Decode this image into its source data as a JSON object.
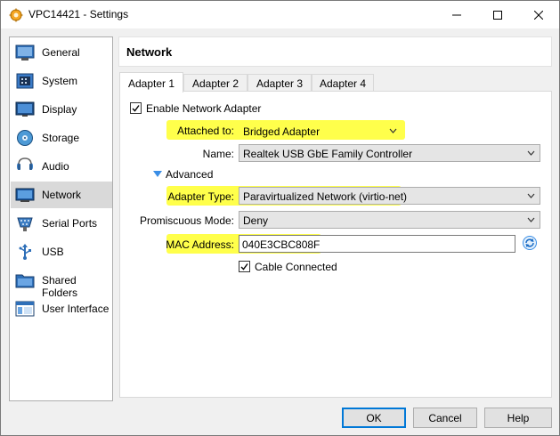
{
  "window": {
    "title": "VPC14421 - Settings"
  },
  "sidebar": {
    "items": [
      {
        "label": "General",
        "icon": "general-icon"
      },
      {
        "label": "System",
        "icon": "system-icon"
      },
      {
        "label": "Display",
        "icon": "display-icon"
      },
      {
        "label": "Storage",
        "icon": "storage-icon"
      },
      {
        "label": "Audio",
        "icon": "audio-icon"
      },
      {
        "label": "Network",
        "icon": "network-icon"
      },
      {
        "label": "Serial Ports",
        "icon": "serial-ports-icon"
      },
      {
        "label": "USB",
        "icon": "usb-icon"
      },
      {
        "label": "Shared Folders",
        "icon": "shared-folders-icon"
      },
      {
        "label": "User Interface",
        "icon": "user-interface-icon"
      }
    ],
    "selected": "Network"
  },
  "content": {
    "header": "Network",
    "tabs": [
      {
        "label": "Adapter 1"
      },
      {
        "label": "Adapter 2"
      },
      {
        "label": "Adapter 3"
      },
      {
        "label": "Adapter 4"
      }
    ],
    "active_tab": "Adapter 1"
  },
  "adapter": {
    "enable_label": "Enable Network Adapter",
    "enable_checked": true,
    "attached_label": "Attached to:",
    "attached_value": "Bridged Adapter",
    "name_label": "Name:",
    "name_value": "Realtek USB GbE Family Controller",
    "advanced_label": "Advanced",
    "adapter_type_label": "Adapter Type:",
    "adapter_type_value": "Paravirtualized Network (virtio-net)",
    "promiscuous_label": "Promiscuous Mode:",
    "promiscuous_value": "Deny",
    "mac_label": "MAC Address:",
    "mac_value": "040E3CBC808F",
    "cable_label": "Cable Connected",
    "cable_checked": true
  },
  "buttons": {
    "ok": "OK",
    "cancel": "Cancel",
    "help": "Help"
  },
  "colors": {
    "highlight": "#ffff2b",
    "accent": "#0078d7"
  }
}
